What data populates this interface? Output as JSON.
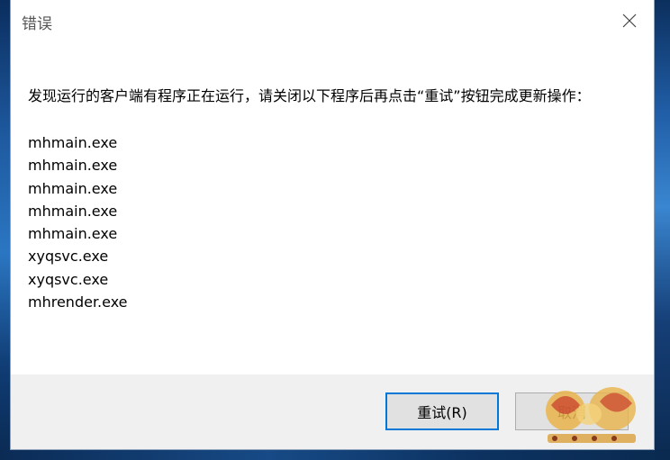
{
  "window": {
    "title": "错误"
  },
  "message": "发现运行的客户端有程序正在运行，请关闭以下程序后再点击“重试”按钮完成更新操作：",
  "processes": [
    "mhmain.exe",
    "mhmain.exe",
    "mhmain.exe",
    "mhmain.exe",
    "mhmain.exe",
    "xyqsvc.exe",
    "xyqsvc.exe",
    "mhrender.exe"
  ],
  "buttons": {
    "retry_label": "重试(R)",
    "cancel_label": "取消"
  },
  "colors": {
    "accent": "#0078d7",
    "footer_bg": "#f0f0f0",
    "button_bg": "#e1e1e1"
  }
}
